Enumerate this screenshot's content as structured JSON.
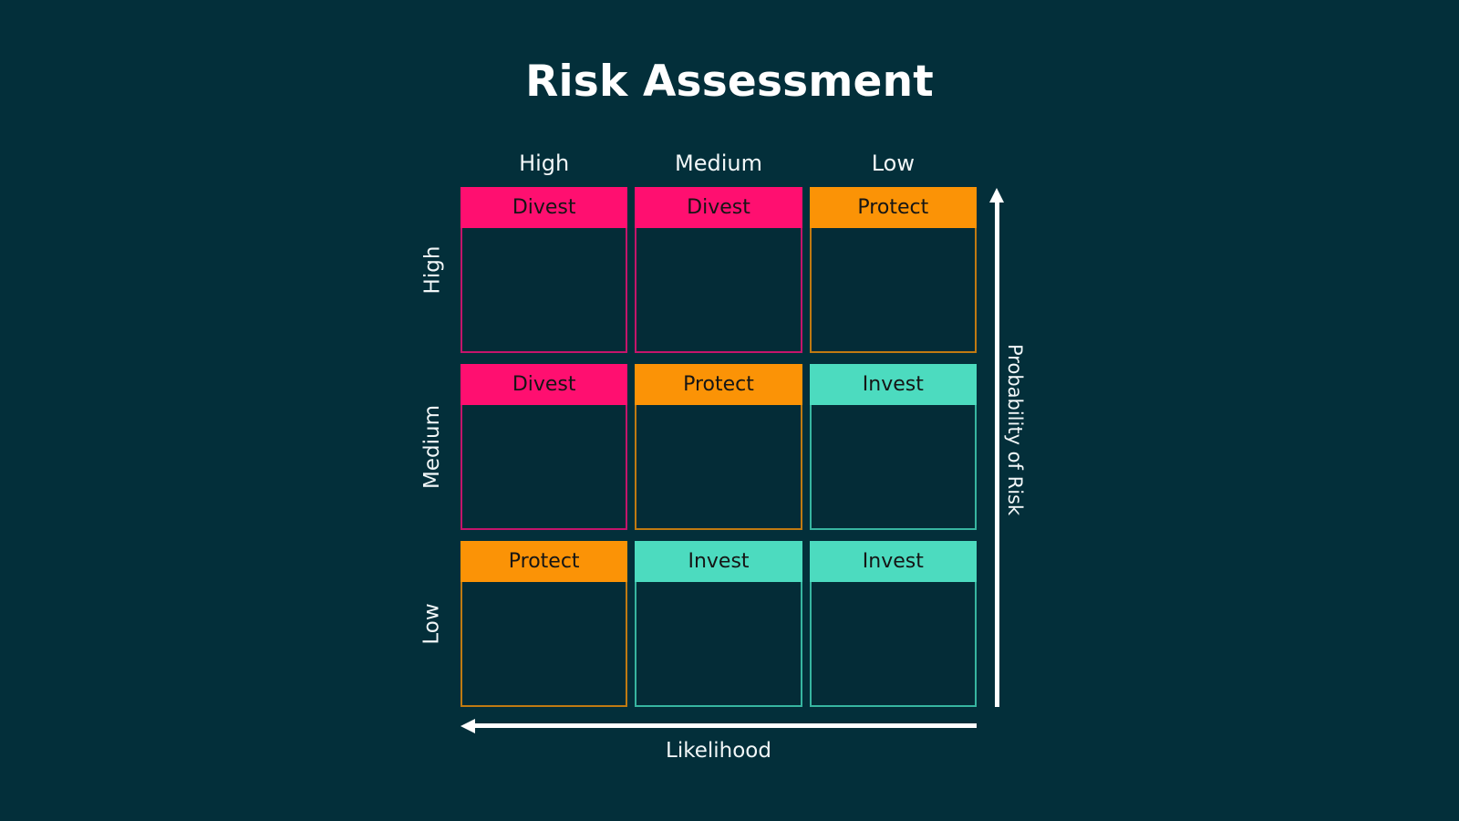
{
  "title": "Risk Assessment",
  "axes": {
    "x_label": "Likelihood",
    "x_arrow_direction": "left",
    "y_label": "Probability of Risk",
    "y_arrow_direction": "up"
  },
  "column_headers": [
    "High",
    "Medium",
    "Low"
  ],
  "row_labels": [
    "High",
    "Medium",
    "Low"
  ],
  "colors": {
    "background": "#032f3a",
    "cell_background": "#042c37",
    "divest": "#ff0f70",
    "divest_border": "#c4156b",
    "protect": "#fb9306",
    "protect_border": "#c07a12",
    "invest": "#4cdbbf",
    "invest_border": "#37b5a0",
    "title": "#ffffff",
    "label": "#f2f7f8",
    "cell_label": "#151515",
    "axis": "#ffffff"
  },
  "chart_data": {
    "type": "heatmap",
    "title": "Risk Assessment",
    "xlabel": "Likelihood",
    "ylabel": "Probability of Risk",
    "categories": [
      "High",
      "Medium",
      "Low"
    ],
    "row_categories": [
      "High",
      "Medium",
      "Low"
    ],
    "legend": [
      "Divest",
      "Protect",
      "Invest"
    ],
    "grid": [
      [
        {
          "label": "Divest",
          "category": "divest",
          "row": "High",
          "column": "High"
        },
        {
          "label": "Divest",
          "category": "divest",
          "row": "High",
          "column": "Medium"
        },
        {
          "label": "Protect",
          "category": "protect",
          "row": "High",
          "column": "Low"
        }
      ],
      [
        {
          "label": "Divest",
          "category": "divest",
          "row": "Medium",
          "column": "High"
        },
        {
          "label": "Protect",
          "category": "protect",
          "row": "Medium",
          "column": "Medium"
        },
        {
          "label": "Invest",
          "category": "invest",
          "row": "Medium",
          "column": "Low"
        }
      ],
      [
        {
          "label": "Protect",
          "category": "protect",
          "row": "Low",
          "column": "High"
        },
        {
          "label": "Invest",
          "category": "invest",
          "row": "Low",
          "column": "Medium"
        },
        {
          "label": "Invest",
          "category": "invest",
          "row": "Low",
          "column": "Low"
        }
      ]
    ]
  }
}
